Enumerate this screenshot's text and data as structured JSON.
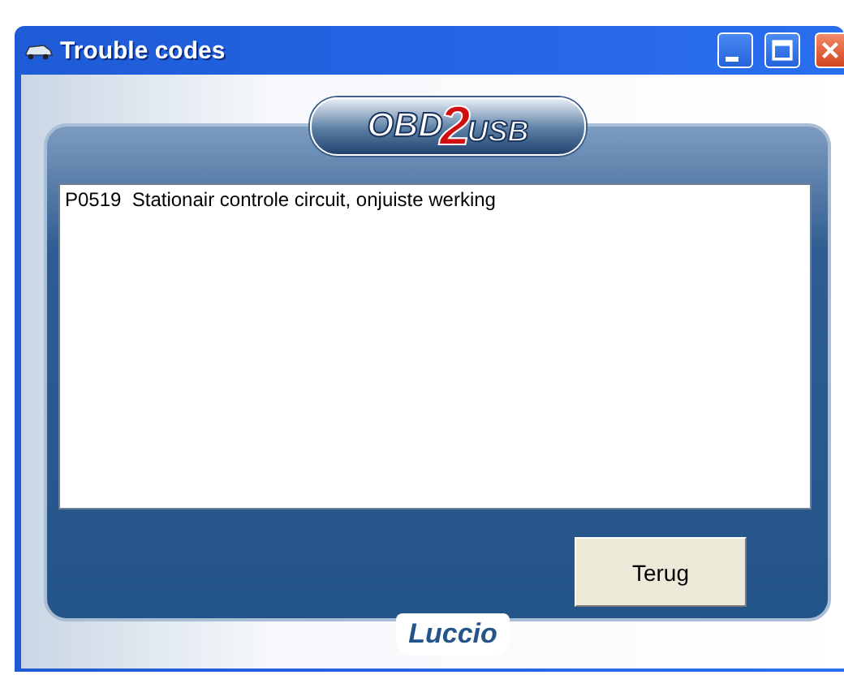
{
  "window": {
    "title": "Trouble codes"
  },
  "logo": {
    "prefix": "OBD",
    "digit": "2",
    "suffix": "USB"
  },
  "codes": [
    {
      "text": "P0519  Stationair controle circuit, onjuiste werking"
    }
  ],
  "buttons": [
    {
      "label": "Terug"
    }
  ],
  "footer_logo": {
    "text": "Luccio"
  }
}
